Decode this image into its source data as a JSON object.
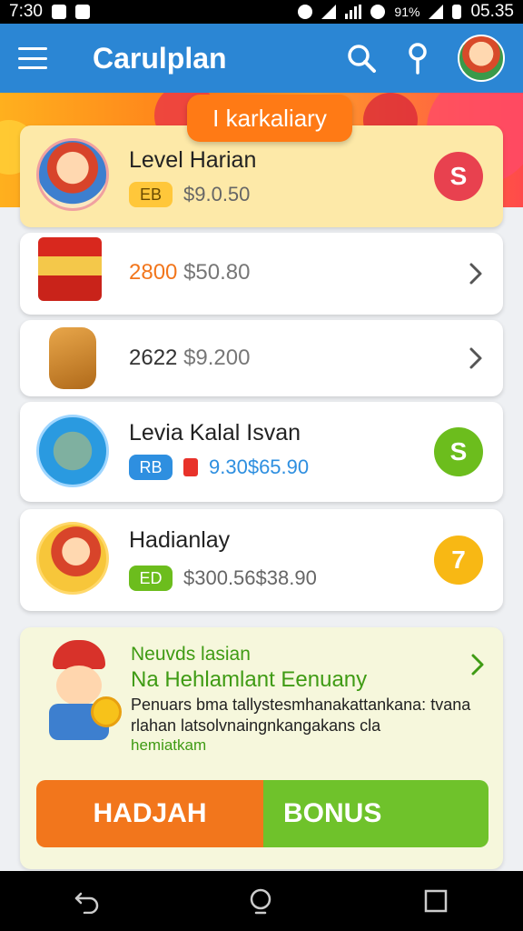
{
  "status_bar": {
    "time": "7:30",
    "battery_text": "91%",
    "clock": "05.35"
  },
  "app_bar": {
    "title": "Carulplan",
    "icons": [
      "menu-icon",
      "search-icon",
      "location-pin-icon",
      "avatar"
    ]
  },
  "banner": {
    "pill_label": "I karkaliary"
  },
  "items": [
    {
      "title": "Level Harian",
      "badge": "EB",
      "price": "$9.0.50",
      "coin": "S",
      "coin_color": "#e8414f",
      "highlight": true
    },
    {
      "primary": "2800",
      "secondary": "$50.80"
    },
    {
      "primary": "2622",
      "secondary": "$9.200"
    },
    {
      "title": "Levia Kalal Isvan",
      "badge": "RB",
      "price_a": "9.30",
      "price_b": "$65.90",
      "coin": "S",
      "coin_color": "#6cbd1d"
    },
    {
      "title": "Hadianlay",
      "badge": "ED",
      "price": "$300.56$38.90",
      "coin": "7",
      "coin_color": "#f8b814"
    }
  ],
  "promo": {
    "title": "Neuvds lasian",
    "subtitle": "Na Hehlamlant Eenuany",
    "body": "Penuars bma tallystesmhanakattankana: tvana rlahan latsolvnaingnkangakans cla",
    "link": "hemiatkam",
    "button_left": "HADJAH",
    "button_right": "BONUS"
  },
  "colors": {
    "primary": "#2b86d4",
    "accent_orange": "#f2761c",
    "accent_green": "#6fc22b",
    "highlight_card": "#fde9a8"
  }
}
